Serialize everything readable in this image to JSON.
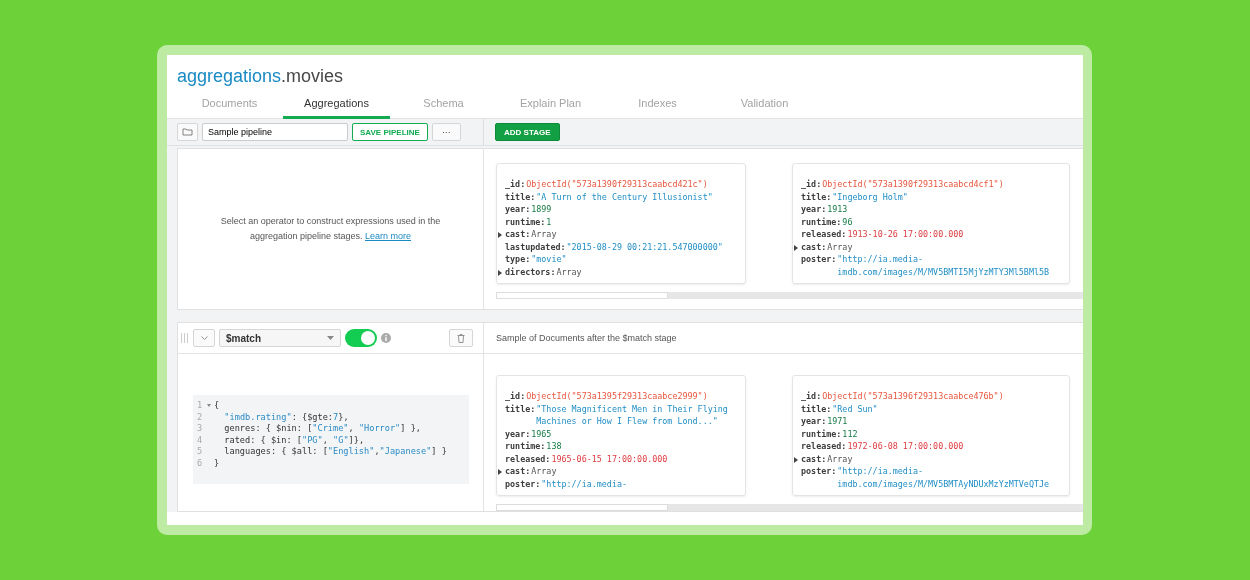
{
  "header": {
    "database": "aggregations",
    "collection": ".movies"
  },
  "tabs": [
    {
      "label": "Documents",
      "selected": false
    },
    {
      "label": "Aggregations",
      "selected": true
    },
    {
      "label": "Schema",
      "selected": false
    },
    {
      "label": "Explain Plan",
      "selected": false
    },
    {
      "label": "Indexes",
      "selected": false
    },
    {
      "label": "Validation",
      "selected": false
    }
  ],
  "toolbar": {
    "pipeline_name": "Sample pipeline",
    "save_button": "SAVE PIPELINE",
    "more_button": "···",
    "add_stage_button": "ADD STAGE"
  },
  "stages": [
    {
      "kind": "intro",
      "description": "Select an operator to construct expressions used in the aggregation pipeline stages.",
      "link": "Learn more",
      "documents": [
        {
          "fields": [
            {
              "key": "_id:",
              "kind": "objectid",
              "value": "ObjectId(\"573a1390f29313caabcd421c\")"
            },
            {
              "key": "title:",
              "kind": "string",
              "value": "\"A Turn of the Century Illusionist\""
            },
            {
              "key": "year:",
              "kind": "number",
              "value": "1899"
            },
            {
              "key": "runtime:",
              "kind": "number",
              "value": "1"
            },
            {
              "key": "cast:",
              "kind": "array",
              "value": "Array"
            },
            {
              "key": "lastupdated:",
              "kind": "string",
              "value": "\"2015-08-29 00:21:21.547000000\""
            },
            {
              "key": "type:",
              "kind": "string",
              "value": "\"movie\""
            },
            {
              "key": "directors:",
              "kind": "array",
              "value": "Array"
            }
          ]
        },
        {
          "fields": [
            {
              "key": "_id:",
              "kind": "objectid",
              "value": "ObjectId(\"573a1390f29313caabcd4cf1\")"
            },
            {
              "key": "title:",
              "kind": "string",
              "value": "\"Ingeborg Holm\""
            },
            {
              "key": "year:",
              "kind": "number",
              "value": "1913"
            },
            {
              "key": "runtime:",
              "kind": "number",
              "value": "96"
            },
            {
              "key": "released:",
              "kind": "date",
              "value": "1913-10-26 17:00:00.000"
            },
            {
              "key": "cast:",
              "kind": "array",
              "value": "Array"
            },
            {
              "key": "poster:",
              "kind": "string",
              "value": "\"http://ia.media-imdb.com/images/M/MV5BMTI5MjYzMTY3Ml5BMl5B"
            }
          ]
        }
      ]
    },
    {
      "kind": "stage",
      "operator": "$match",
      "enabled": true,
      "sample_label": "Sample of Documents after the $match stage",
      "code": [
        {
          "number": "1",
          "text": "{",
          "foldable": true
        },
        {
          "number": "2",
          "text": "  \"imdb.rating\": {$gte:7},",
          "foldable": false
        },
        {
          "number": "3",
          "text": "  genres: { $nin: [\"Crime\", \"Horror\"] },",
          "foldable": false
        },
        {
          "number": "4",
          "text": "  rated: { $in: [\"PG\", \"G\"]},",
          "foldable": false
        },
        {
          "number": "5",
          "text": "  languages: { $all: [\"English\",\"Japanese\"] }",
          "foldable": false
        },
        {
          "number": "6",
          "text": "}",
          "foldable": false
        }
      ],
      "documents": [
        {
          "fields": [
            {
              "key": "_id:",
              "kind": "objectid",
              "value": "ObjectId(\"573a1395f29313caabce2999\")"
            },
            {
              "key": "title:",
              "kind": "string",
              "value": "\"Those Magnificent Men in Their Flying Machines or How I Flew from Lond...\""
            },
            {
              "key": "year:",
              "kind": "number",
              "value": "1965"
            },
            {
              "key": "runtime:",
              "kind": "number",
              "value": "138"
            },
            {
              "key": "released:",
              "kind": "date",
              "value": "1965-06-15 17:00:00.000"
            },
            {
              "key": "cast:",
              "kind": "array",
              "value": "Array"
            },
            {
              "key": "poster:",
              "kind": "string",
              "value": "\"http://ia.media-"
            }
          ]
        },
        {
          "fields": [
            {
              "key": "_id:",
              "kind": "objectid",
              "value": "ObjectId(\"573a1396f29313caabce476b\")"
            },
            {
              "key": "title:",
              "kind": "string",
              "value": "\"Red Sun\""
            },
            {
              "key": "year:",
              "kind": "number",
              "value": "1971"
            },
            {
              "key": "runtime:",
              "kind": "number",
              "value": "112"
            },
            {
              "key": "released:",
              "kind": "date",
              "value": "1972-06-08 17:00:00.000"
            },
            {
              "key": "cast:",
              "kind": "array",
              "value": "Array"
            },
            {
              "key": "poster:",
              "kind": "string",
              "value": "\"http://ia.media-imdb.com/images/M/MV5BMTAyNDUxMzYzMTVeQTJe"
            }
          ]
        }
      ]
    }
  ]
}
